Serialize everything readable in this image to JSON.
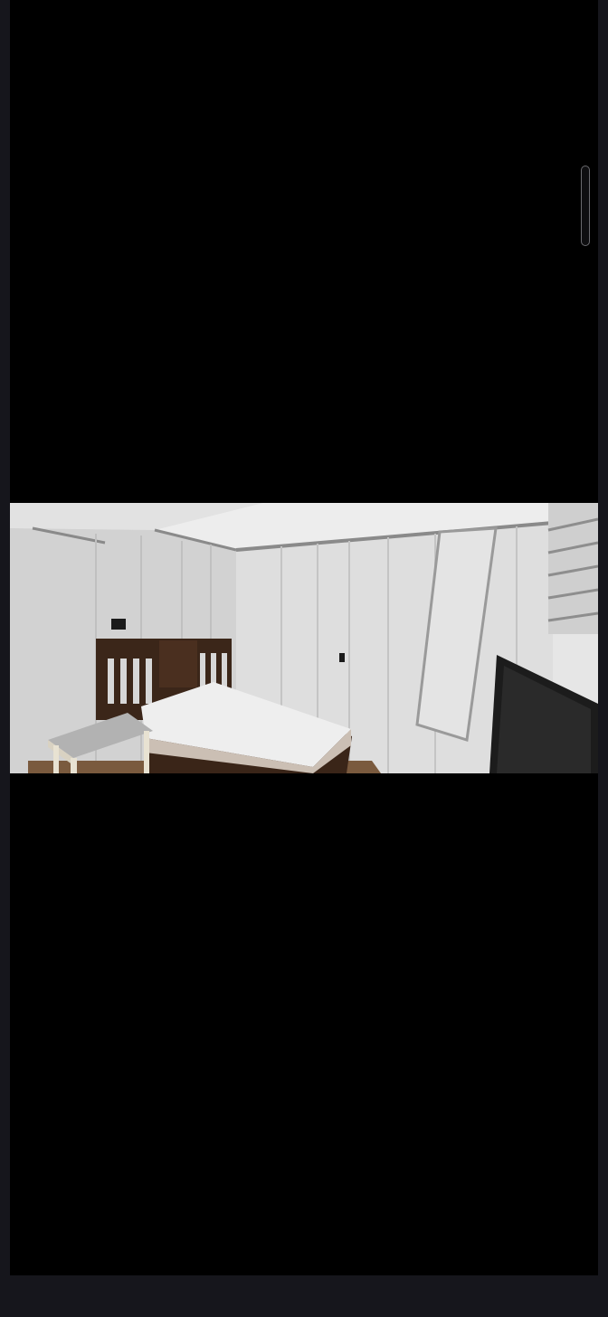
{
  "viewer": {
    "background_color": "#16161c",
    "stage_color": "#000000"
  },
  "photo": {
    "subject_icon": "image-photo",
    "dominant_colors": [
      "#e8e8e8",
      "#3d2a20",
      "#1a1a1a"
    ]
  },
  "scrollbar": {
    "thumb_color": "#0e0e10",
    "border_color": "#6a6a6e"
  }
}
